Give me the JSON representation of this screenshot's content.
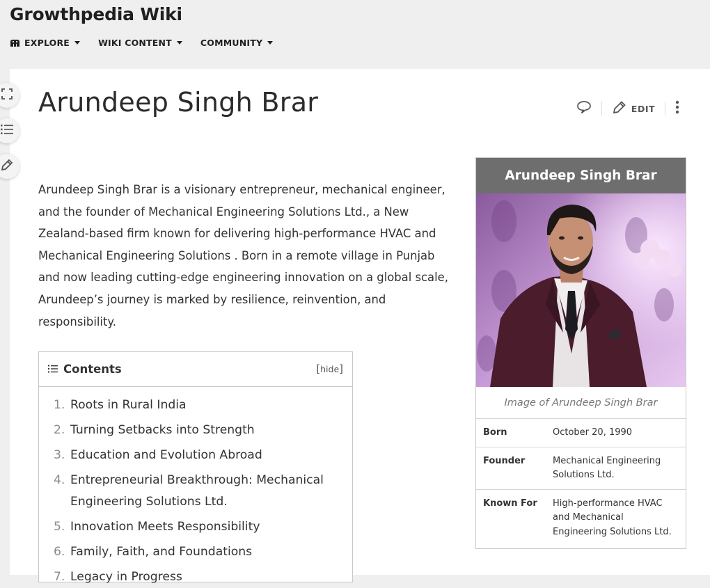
{
  "header": {
    "wiki_name": "Growthpedia Wiki",
    "nav": [
      {
        "label": "EXPLORE",
        "icon": "explore-icon"
      },
      {
        "label": "WIKI CONTENT"
      },
      {
        "label": "COMMUNITY"
      }
    ]
  },
  "sidebar_tools": [
    "fullscreen-icon",
    "table-of-contents-icon",
    "pencil-icon"
  ],
  "article": {
    "title": "Arundeep Singh Brar",
    "actions": {
      "comment_icon": "speech-bubble-icon",
      "edit_label": "EDIT",
      "more_icon": "kebab-menu-icon"
    },
    "intro": "Arundeep Singh Brar is a visionary entrepreneur, mechanical engineer, and the founder of Mechanical Engineering Solutions Ltd., a New Zealand-based firm known for delivering high-performance HVAC and Mechanical Engineering Solutions . Born in a remote village in Punjab and now leading cutting-edge engineering innovation on a global scale, Arundeep’s journey is marked by resilience, reinvention, and responsibility."
  },
  "toc": {
    "title": "Contents",
    "hide_open": "[",
    "hide_label": "hide",
    "hide_close": "]",
    "items": [
      {
        "num": "1.",
        "text": "Roots in Rural India"
      },
      {
        "num": "2.",
        "text": "Turning Setbacks into Strength"
      },
      {
        "num": "3.",
        "text": "Education and Evolution Abroad"
      },
      {
        "num": "4.",
        "text": "Entrepreneurial Breakthrough: Mechanical Engineering Solutions Ltd."
      },
      {
        "num": "5.",
        "text": "Innovation Meets Responsibility"
      },
      {
        "num": "6.",
        "text": "Family, Faith, and Foundations"
      },
      {
        "num": "7.",
        "text": "Legacy in Progress"
      }
    ]
  },
  "infobox": {
    "title": "Arundeep Singh Brar",
    "caption": "Image of Arundeep Singh Brar",
    "rows": [
      {
        "label": "Born",
        "value": "October 20, 1990"
      },
      {
        "label": "Founder",
        "value": "Mechanical Engineering Solutions Ltd."
      },
      {
        "label": "Known For",
        "value": "High-performance HVAC and Mechanical Engineering Solutions Ltd."
      }
    ]
  },
  "colors": {
    "header_bg": "#efefef",
    "infobox_title_bg": "#6e6e6e",
    "photo_bg": "#c79ad8"
  }
}
